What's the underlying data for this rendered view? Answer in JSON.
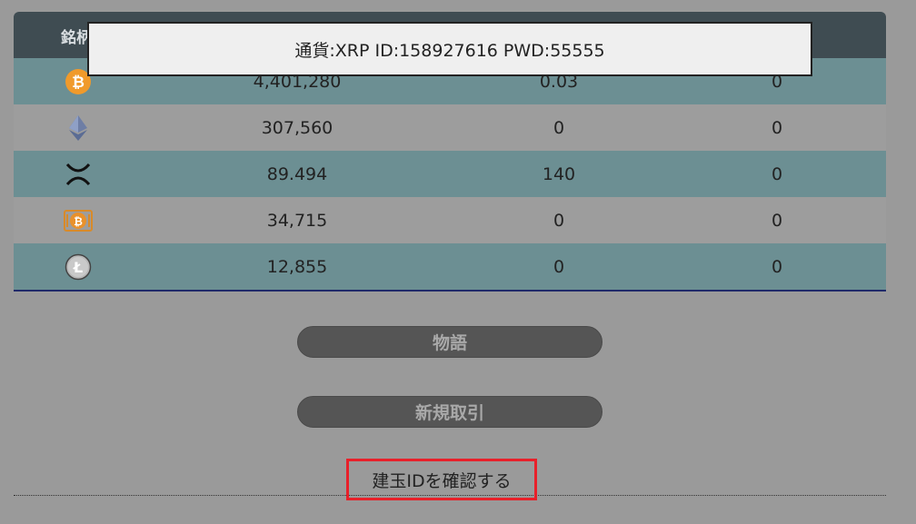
{
  "modal": {
    "text": "通貨:XRP ID:158927616 PWD:55555"
  },
  "table": {
    "header_first": "銘柄",
    "rows": [
      {
        "coin_icon": "bitcoin-icon",
        "price": "4,401,280",
        "col_a": "0.03",
        "col_b": "0"
      },
      {
        "coin_icon": "ethereum-icon",
        "price": "307,560",
        "col_a": "0",
        "col_b": "0"
      },
      {
        "coin_icon": "xrp-icon",
        "price": "89.494",
        "col_a": "140",
        "col_b": "0"
      },
      {
        "coin_icon": "bitcoin-cash-icon",
        "price": "34,715",
        "col_a": "0",
        "col_b": "0"
      },
      {
        "coin_icon": "litecoin-icon",
        "price": "12,855",
        "col_a": "0",
        "col_b": "0"
      }
    ]
  },
  "buttons": {
    "story": "物語",
    "new_trade": "新規取引",
    "confirm_position": "建玉IDを確認する"
  },
  "colors": {
    "row_teal": "#6c8f93",
    "row_gray": "#9d9d9d",
    "header": "#3f4c52",
    "highlight_border": "#e8202a"
  }
}
